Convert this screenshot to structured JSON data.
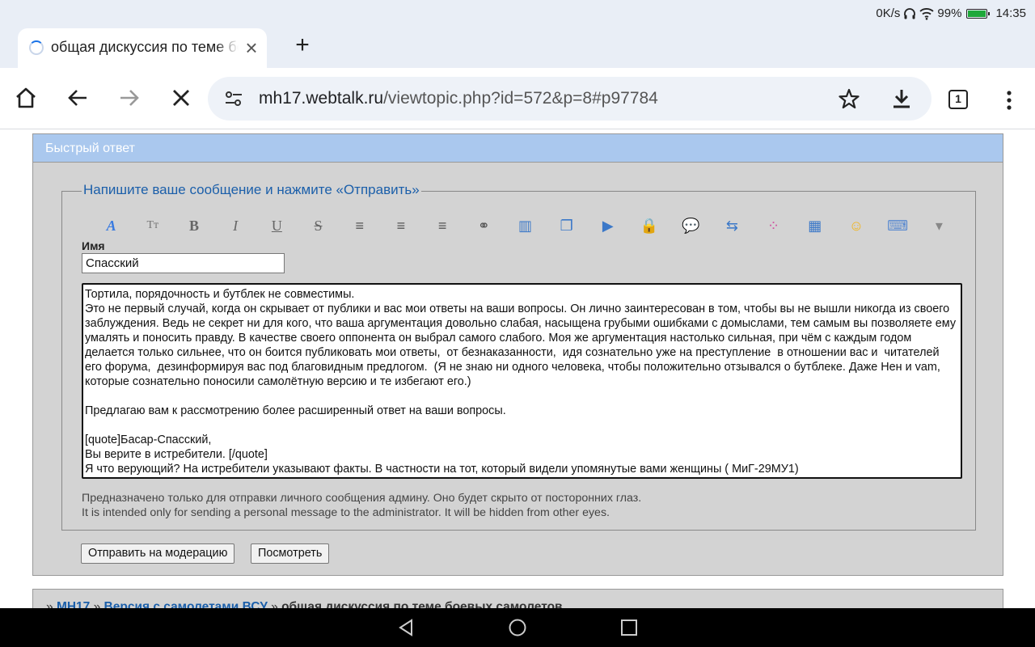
{
  "status": {
    "net_speed": "0K/s",
    "battery_pct": "99%",
    "time": "14:35"
  },
  "tab": {
    "title": "общая дискуссия по теме боевых самолетов"
  },
  "omnibox": {
    "host": "mh17.webtalk.ru",
    "path": "/viewtopic.php?id=572&p=8#p97784"
  },
  "toolbar": {
    "tab_count": "1"
  },
  "page": {
    "block_title": "Быстрый ответ",
    "legend": "Напишите ваше сообщение и нажмите «Отправить»",
    "name_label": "Имя",
    "name_value": "Спасский",
    "message": "Тортила, порядочность и бутблек не совместимы.\nЭто не первый случай, когда он скрывает от публики и вас мои ответы на ваши вопросы. Он лично заинтересован в том, чтобы вы не вышли никогда из своего заблуждения. Ведь не секрет ни для кого, что ваша аргументация довольно слабая, насыщена грубыми ошибками с домыслами, тем самым вы позволяете ему умалять и поносить правду. В качестве своего оппонента он выбрал самого слабого. Моя же аргументация настолько сильная, при чём с каждым годом делается только сильнее, что он боится публиковать мои ответы,  от безнаказанности,  идя сознательно уже на преступление  в отношении вас и  читателей его форума,  дезинформируя вас под благовидным предлогом.  (Я не знаю ни одного человека, чтобы положительно отзывался о бутблеке. Даже Нен и vam, которые сознательно поносили самолётную версию и те избегают его.)\n\nПредлагаю вам к рассмотрению более расширенный ответ на ваши вопросы.\n\n[quote]Басар-Спасский,\nВы верите в истребители. [/quote]\nЯ что верующий? На истребители указывают факты. В частности на тот, который видели упомянутые вами женщины ( МиГ-29МУ1)",
    "note_ru": "Предназначено только для отправки личного сообщения админу. Оно будет скрыто от посторонних глаз.",
    "note_en": "It is intended only for sending a personal message to the administrator. It will be hidden from other eyes.",
    "submit_label": "Отправить на модерацию",
    "preview_label": "Посмотреть",
    "breadcrumb": {
      "sep": "»",
      "forum": "MH17",
      "section": "Версия с самолетами ВСУ",
      "topic": "общая дискуссия по теме боевых самолетов"
    }
  },
  "bbcode_buttons": [
    {
      "name": "font-color-icon",
      "glyph": "A",
      "color": "#3a7be0"
    },
    {
      "name": "font-size-icon",
      "glyph": "Tт",
      "color": "#777777"
    },
    {
      "name": "bold-icon",
      "glyph": "B",
      "color": "#666666"
    },
    {
      "name": "italic-icon",
      "glyph": "I",
      "color": "#666666"
    },
    {
      "name": "underline-icon",
      "glyph": "U",
      "color": "#666666"
    },
    {
      "name": "strikethrough-icon",
      "glyph": "S",
      "color": "#666666"
    },
    {
      "name": "align-left-icon",
      "glyph": "≡",
      "color": "#555555"
    },
    {
      "name": "align-center-icon",
      "glyph": "≡",
      "color": "#555555"
    },
    {
      "name": "align-right-icon",
      "glyph": "≡",
      "color": "#555555"
    },
    {
      "name": "link-icon",
      "glyph": "⚭",
      "color": "#555555"
    },
    {
      "name": "book-icon",
      "glyph": "▥",
      "color": "#3b78c8"
    },
    {
      "name": "copy-icon",
      "glyph": "❐",
      "color": "#3b78c8"
    },
    {
      "name": "video-icon",
      "glyph": "▶",
      "color": "#3b78c8"
    },
    {
      "name": "lock-icon",
      "glyph": "🔒",
      "color": "#e0a22a"
    },
    {
      "name": "speech-bubble-icon",
      "glyph": "💬",
      "color": "#3b78c8"
    },
    {
      "name": "image-icon",
      "glyph": "⇆",
      "color": "#3b78c8"
    },
    {
      "name": "color-palette-icon",
      "glyph": "⁘",
      "color": "#d04fa0"
    },
    {
      "name": "table-icon",
      "glyph": "▦",
      "color": "#3b78c8"
    },
    {
      "name": "smiley-icon",
      "glyph": "☺",
      "color": "#f2b51e"
    },
    {
      "name": "keyboard-icon",
      "glyph": "⌨",
      "color": "#5a8ad0"
    },
    {
      "name": "more-dropdown-icon",
      "glyph": "▾",
      "color": "#888888"
    }
  ]
}
